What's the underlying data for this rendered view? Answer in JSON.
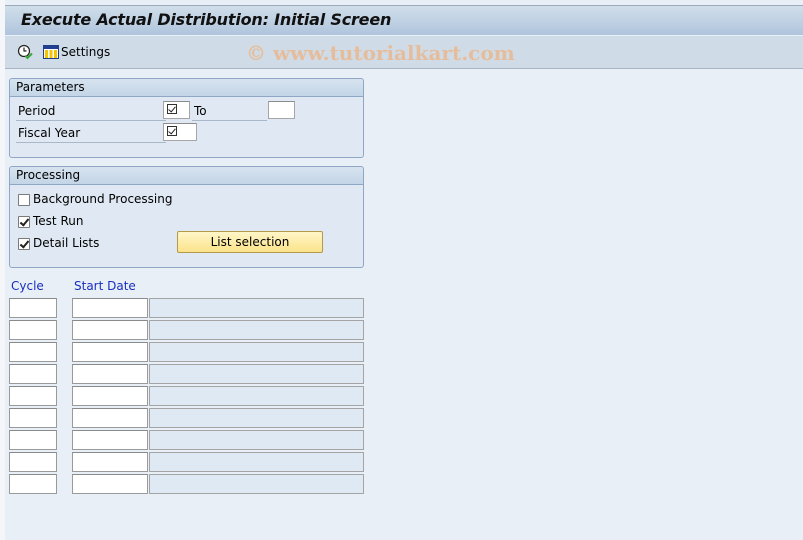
{
  "window": {
    "title": "Execute Actual Distribution: Initial Screen"
  },
  "toolbar": {
    "execute_icon": "execute-clock-icon",
    "settings_icon": "table-settings-icon",
    "settings_label": "Settings"
  },
  "watermark": "© www.tutorialkart.com",
  "parameters": {
    "header": "Parameters",
    "period_label": "Period",
    "period_from": "",
    "to_label": "To",
    "period_to": "",
    "fiscal_year_label": "Fiscal Year",
    "fiscal_year": "",
    "required_icon": "required-entry-icon"
  },
  "processing": {
    "header": "Processing",
    "options": [
      {
        "label": "Background Processing",
        "checked": false
      },
      {
        "label": "Test Run",
        "checked": true
      },
      {
        "label": "Detail Lists",
        "checked": true
      }
    ],
    "list_selection_button": "List selection"
  },
  "cycles": {
    "columns": [
      "Cycle",
      "Start Date"
    ],
    "rows": [
      {
        "cycle": "",
        "start_date": "",
        "description": ""
      },
      {
        "cycle": "",
        "start_date": "",
        "description": ""
      },
      {
        "cycle": "",
        "start_date": "",
        "description": ""
      },
      {
        "cycle": "",
        "start_date": "",
        "description": ""
      },
      {
        "cycle": "",
        "start_date": "",
        "description": ""
      },
      {
        "cycle": "",
        "start_date": "",
        "description": ""
      },
      {
        "cycle": "",
        "start_date": "",
        "description": ""
      },
      {
        "cycle": "",
        "start_date": "",
        "description": ""
      },
      {
        "cycle": "",
        "start_date": "",
        "description": ""
      }
    ]
  },
  "colors": {
    "background": "#e8eff7",
    "title_bar": "#afc5dd",
    "toolbar": "#cfdce7",
    "column_header_text": "#1a2fbf",
    "button_fill": "#fbe38a"
  }
}
